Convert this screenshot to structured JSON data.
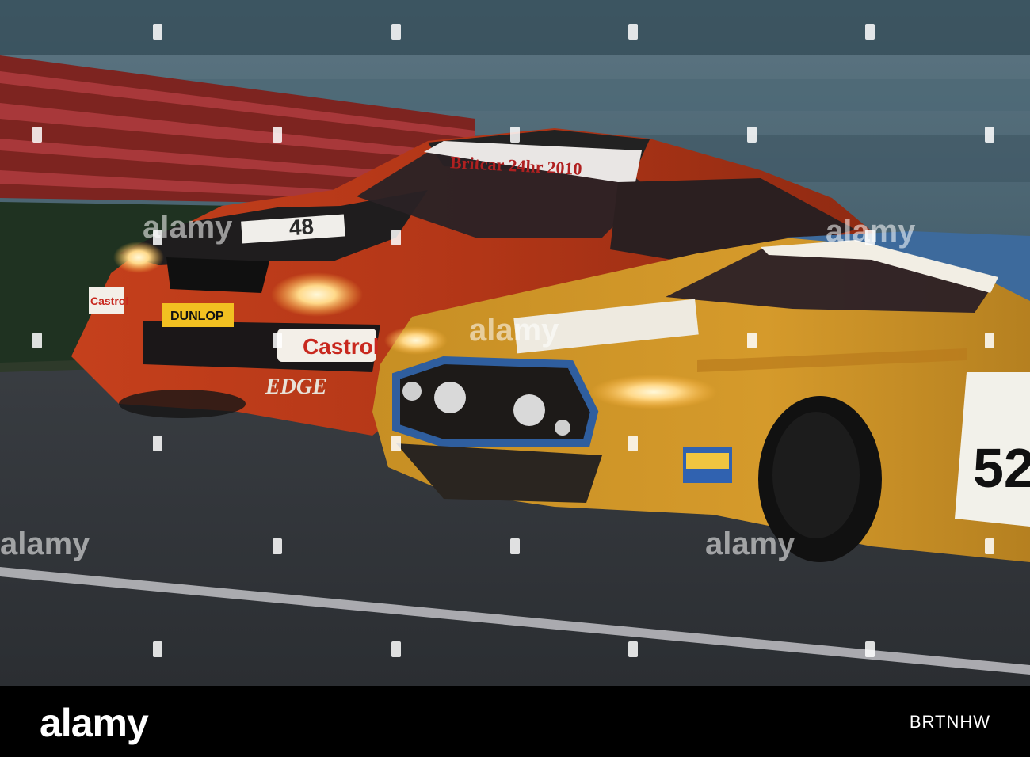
{
  "image": {
    "description_labels": {
      "car_left_number": "48",
      "car_right_number": "52",
      "car_left_sponsors": [
        "Castrol",
        "DUNLOP",
        "EDGE",
        "Castrol"
      ],
      "windscreen_banner": "Britcar 24hr 2010"
    }
  },
  "watermark": {
    "text": "alamy"
  },
  "footer": {
    "logo": "alamy",
    "image_id": "BRTNHW"
  }
}
